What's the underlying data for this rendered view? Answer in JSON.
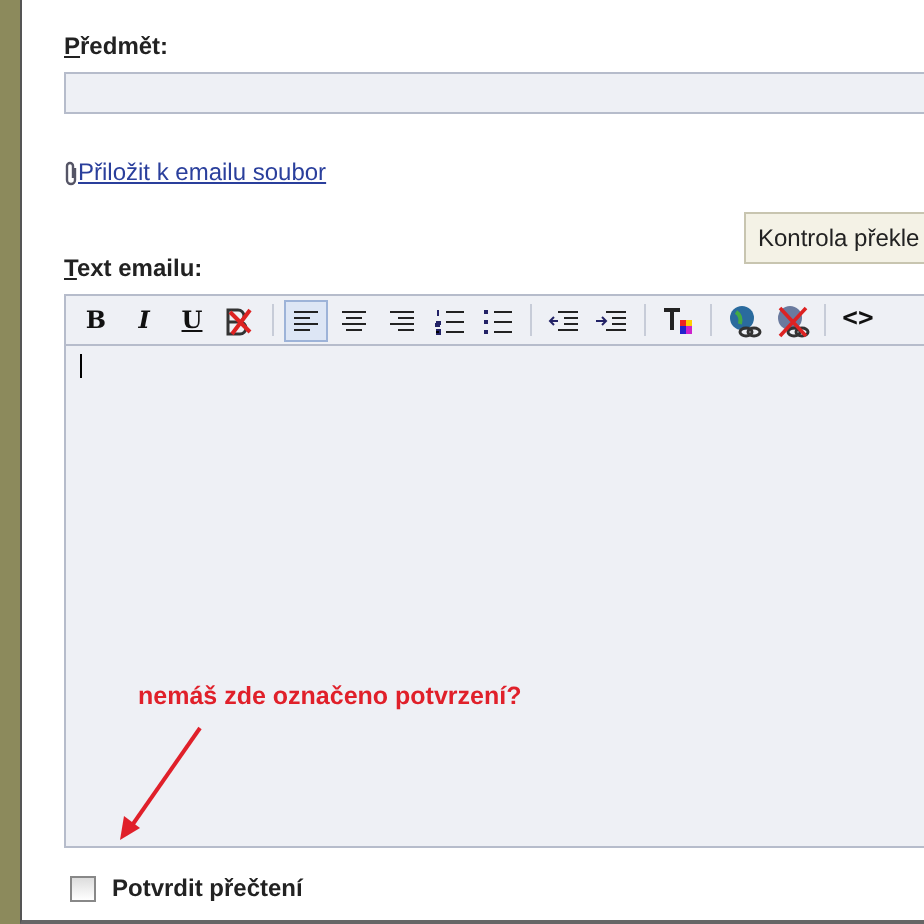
{
  "subject": {
    "label": "Předmět:"
  },
  "attach_link": "Přiložit k emailu soubor",
  "tooltip": "Kontrola překle",
  "body_label": "Text emailu:",
  "toolbar": [
    {
      "kind": "text",
      "label": "B",
      "selected": false
    },
    {
      "kind": "text",
      "label": "I",
      "selected": false
    },
    {
      "kind": "text",
      "label": "U",
      "selected": false
    },
    {
      "kind": "icon",
      "selected": false
    },
    {
      "kind": "separator"
    },
    {
      "kind": "icon",
      "selected": true
    },
    {
      "kind": "icon",
      "selected": false
    },
    {
      "kind": "icon",
      "selected": false
    },
    {
      "kind": "icon",
      "selected": false
    },
    {
      "kind": "icon",
      "selected": false
    },
    {
      "kind": "separator"
    },
    {
      "kind": "icon",
      "selected": false
    },
    {
      "kind": "icon",
      "selected": false
    },
    {
      "kind": "separator"
    },
    {
      "kind": "icon",
      "selected": false
    },
    {
      "kind": "separator"
    },
    {
      "kind": "icon",
      "selected": false
    },
    {
      "kind": "icon",
      "selected": false
    },
    {
      "kind": "separator"
    },
    {
      "kind": "text",
      "label": "<>",
      "selected": false
    }
  ],
  "annotation": "nemáš zde označeno potvrzení?",
  "read_receipt": {
    "label": "Potvrdit přečtení",
    "checked": false
  }
}
